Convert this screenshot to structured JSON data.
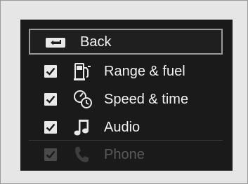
{
  "menu": {
    "back_label": "Back",
    "items": [
      {
        "label": "Range & fuel",
        "checked": true,
        "icon": "range-fuel-icon",
        "enabled": true
      },
      {
        "label": "Speed & time",
        "checked": true,
        "icon": "speed-time-icon",
        "enabled": true
      },
      {
        "label": "Audio",
        "checked": true,
        "icon": "audio-note-icon",
        "enabled": true
      },
      {
        "label": "Phone",
        "checked": true,
        "icon": "phone-icon",
        "enabled": false
      }
    ]
  },
  "colors": {
    "screen_bg": "#1a1a1a",
    "text": "#f2f2f2",
    "text_dim": "#5a5a5a",
    "highlight_border": "#9a9a9a"
  }
}
